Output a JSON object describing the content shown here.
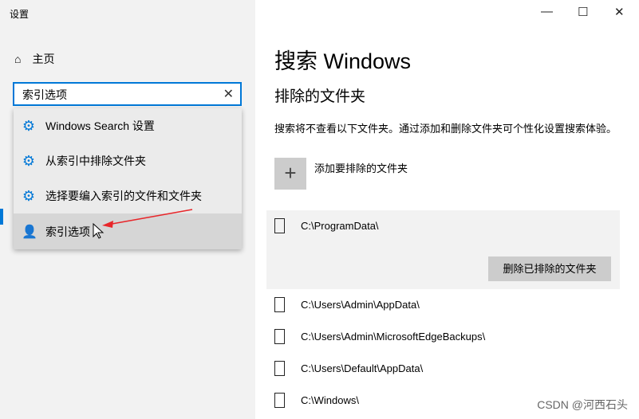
{
  "window": {
    "title": "设置",
    "controls": {
      "minimize": "—",
      "maximize": "☐",
      "close": "✕"
    }
  },
  "sidebar": {
    "home_label": "主页",
    "home_icon": "⌂"
  },
  "search": {
    "value": "索引选项",
    "clear": "✕"
  },
  "dropdown": {
    "items": [
      {
        "label": "Windows Search 设置",
        "icon": "gear-icon"
      },
      {
        "label": "从索引中排除文件夹",
        "icon": "gear-icon"
      },
      {
        "label": "选择要编入索引的文件和文件夹",
        "icon": "gear-icon"
      },
      {
        "label": "索引选项",
        "icon": "indexing-options-icon"
      }
    ],
    "gear": "⚙",
    "user": "👤"
  },
  "main": {
    "title": "搜索 Windows",
    "section": "排除的文件夹",
    "description": "搜索将不查看以下文件夹。通过添加和删除文件夹可个性化设置搜索体验。",
    "add_label": "添加要排除的文件夹",
    "add_icon": "+",
    "remove_label": "删除已排除的文件夹",
    "folders": [
      "C:\\ProgramData\\",
      "C:\\Users\\Admin\\AppData\\",
      "C:\\Users\\Admin\\MicrosoftEdgeBackups\\",
      "C:\\Users\\Default\\AppData\\",
      "C:\\Windows\\"
    ]
  },
  "watermark": "CSDN @河西石头",
  "colors": {
    "accent": "#0078d7",
    "annotation": "#e8262a"
  }
}
